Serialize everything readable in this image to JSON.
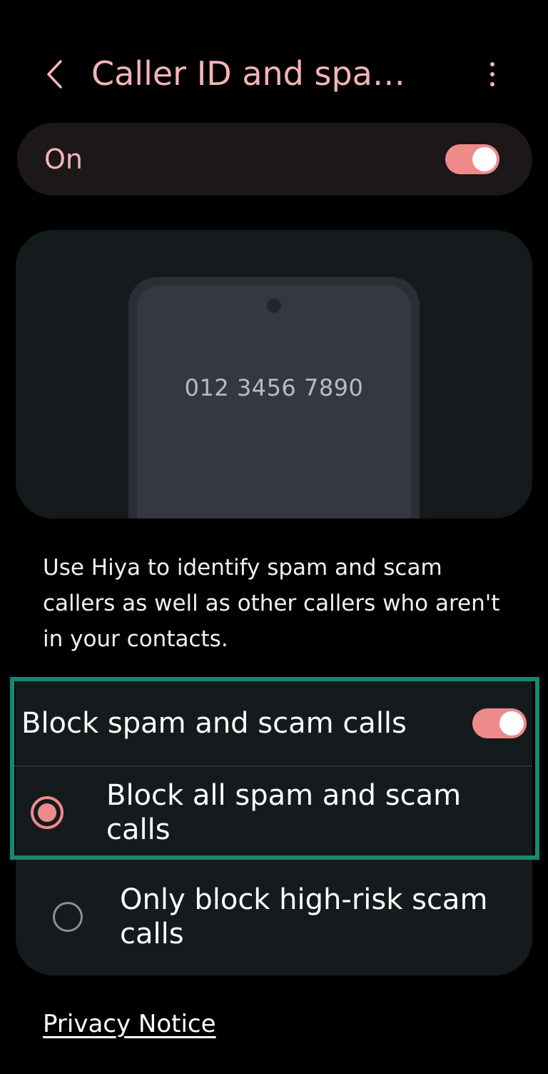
{
  "header": {
    "title": "Caller ID and spam...",
    "back_icon": "chevron-left-icon",
    "more_icon": "more-vertical-icon"
  },
  "master_switch": {
    "label": "On",
    "state": true
  },
  "illustration": {
    "phone_number": "012 3456 7890"
  },
  "description": "Use Hiya to identify spam and scam callers as well as other callers who aren't in your contacts.",
  "block_settings": {
    "label": "Block spam and scam calls",
    "state": true,
    "options": [
      {
        "label": "Block all spam and scam calls",
        "selected": true
      },
      {
        "label": "Only block high-risk scam calls",
        "selected": false
      }
    ]
  },
  "privacy_notice": "Privacy Notice",
  "colors": {
    "accent": "#ef8a8b",
    "title": "#f4b4b6",
    "card": "#151b1c",
    "highlight": "#138a72"
  }
}
